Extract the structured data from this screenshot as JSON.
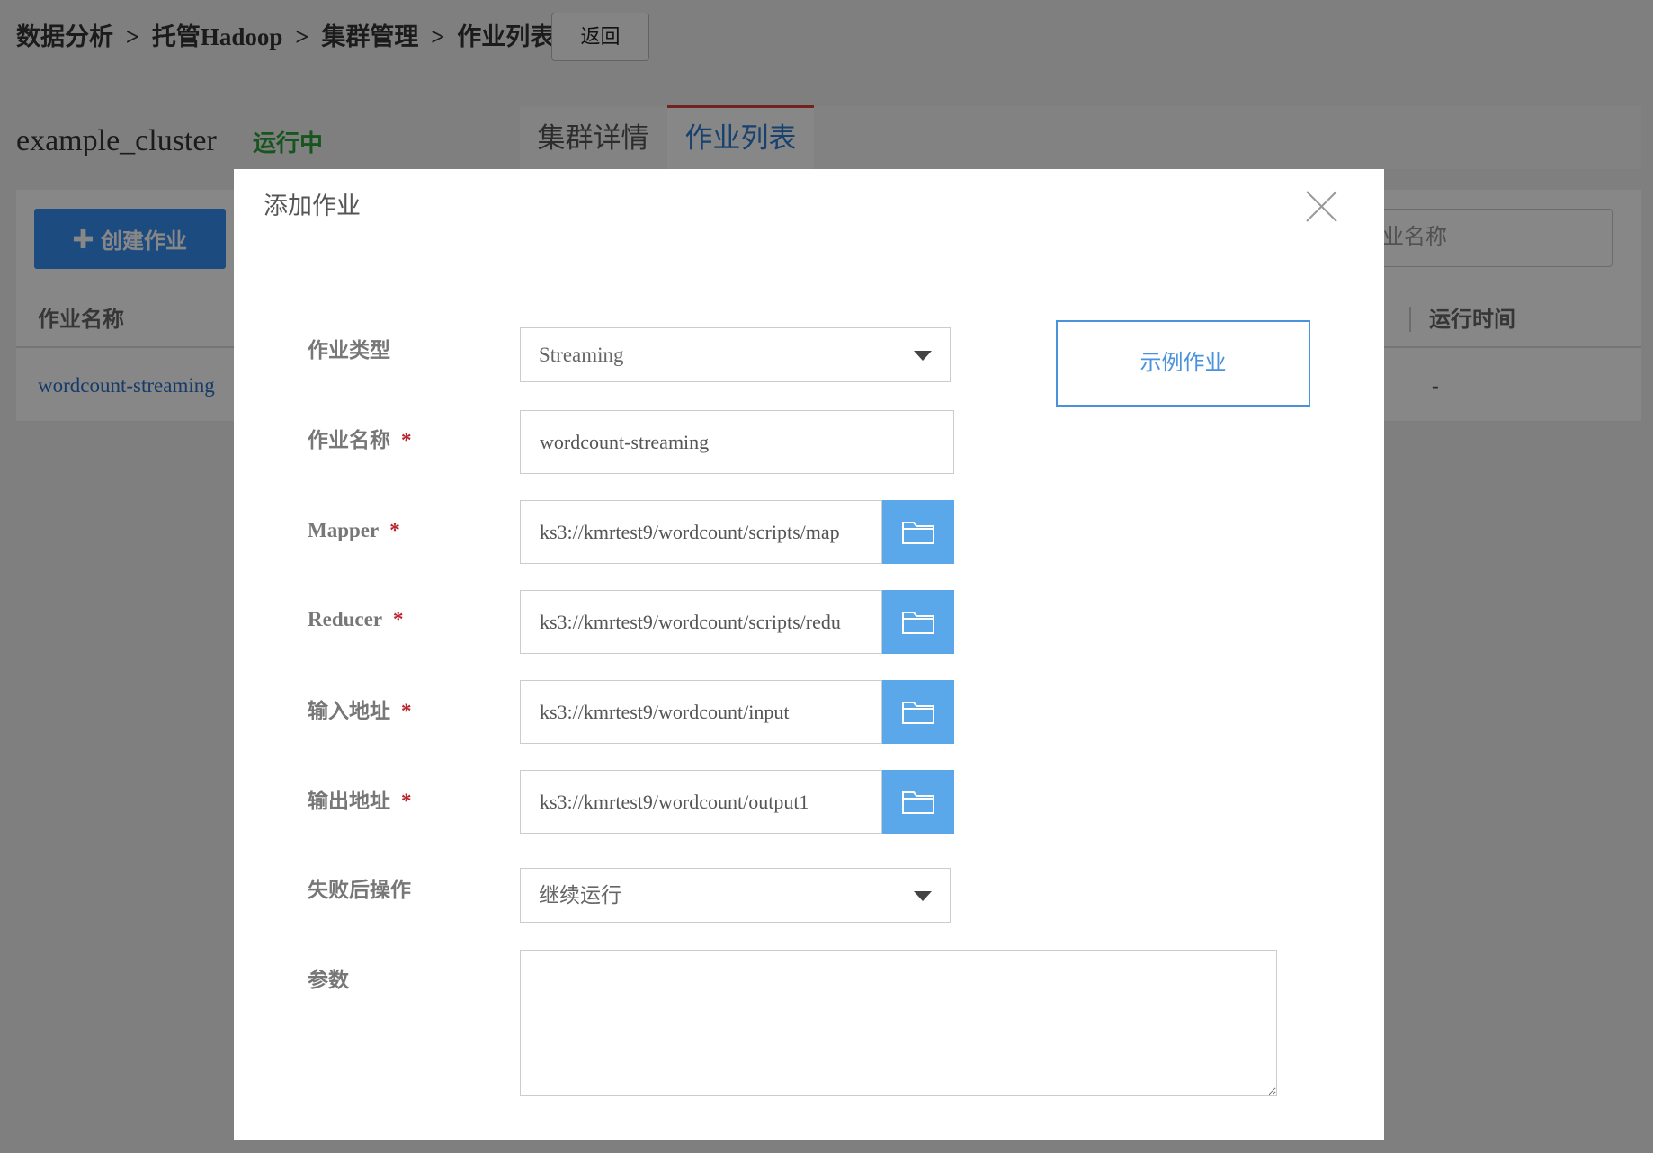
{
  "breadcrumb": {
    "items": [
      "数据分析",
      "托管Hadoop",
      "集群管理",
      "作业列表"
    ],
    "separator": ">"
  },
  "back_button": "返回",
  "cluster": {
    "name": "example_cluster",
    "status": "运行中"
  },
  "tabs": [
    {
      "label": "集群详情",
      "active": false
    },
    {
      "label": "作业列表",
      "active": true
    }
  ],
  "toolbar": {
    "create_button": "创建作业",
    "search_placeholder": "作业名称"
  },
  "jobs_table": {
    "columns": [
      "作业名称",
      "运行时间"
    ],
    "rows": [
      {
        "name": "wordcount-streaming",
        "run_time": "-"
      }
    ]
  },
  "modal": {
    "title": "添加作业",
    "example_button": "示例作业",
    "required_mark": "*",
    "fields": {
      "job_type": {
        "label": "作业类型",
        "value": "Streaming"
      },
      "job_name": {
        "label": "作业名称",
        "required": true,
        "value": "wordcount-streaming"
      },
      "mapper": {
        "label": "Mapper",
        "required": true,
        "value": "ks3://kmrtest9/wordcount/scripts/map"
      },
      "reducer": {
        "label": "Reducer",
        "required": true,
        "value": "ks3://kmrtest9/wordcount/scripts/redu"
      },
      "input_path": {
        "label": "输入地址",
        "required": true,
        "value": "ks3://kmrtest9/wordcount/input"
      },
      "output_path": {
        "label": "输出地址",
        "required": true,
        "value": "ks3://kmrtest9/wordcount/output1"
      },
      "on_failure": {
        "label": "失败后操作",
        "value": "继续运行"
      },
      "params": {
        "label": "参数",
        "value": ""
      }
    }
  },
  "icons": {
    "close": "close-icon",
    "folder": "folder-icon",
    "dropdown": "caret-down-icon",
    "add": "plus-icon",
    "textarea_resize": "resize-handle-icon"
  },
  "colors": {
    "primary": "#338ef0",
    "link": "#2a6fc7",
    "running": "#2aa13a",
    "required": "#b8232a",
    "folder": "#5aa8ea",
    "tab-border": "#d9413a",
    "tab-active-text": "#2c7bd0",
    "overlay": "rgba(0,0,0,0.47)"
  }
}
